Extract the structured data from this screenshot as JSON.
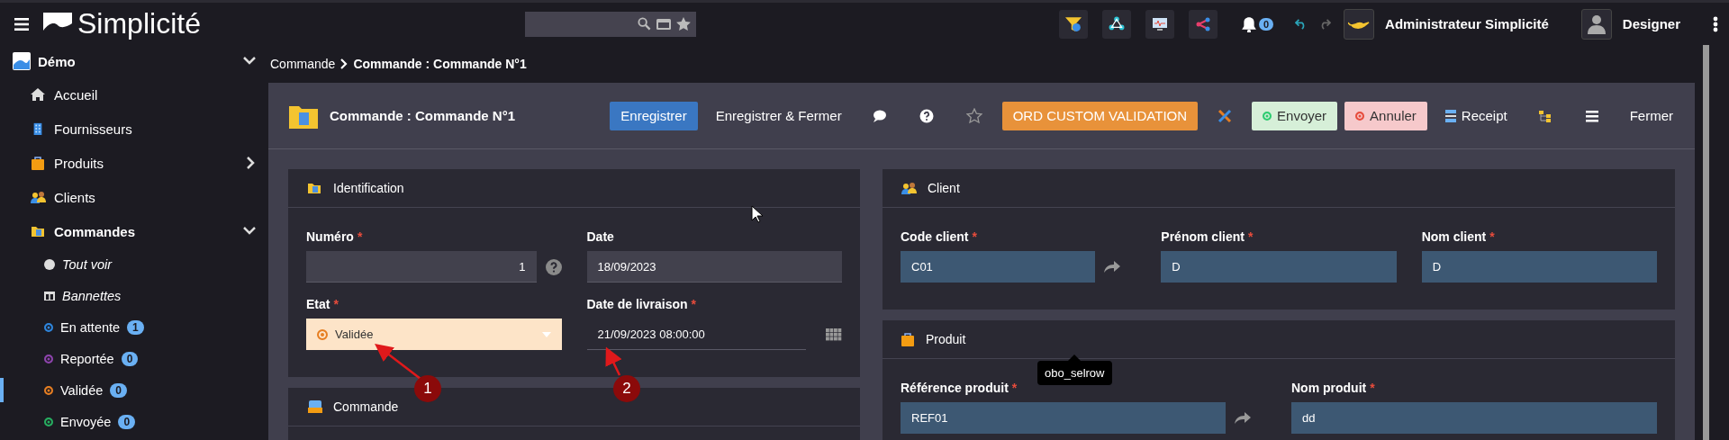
{
  "topbar": {
    "app_name": "Simplicité",
    "notification_count": "0",
    "user": "Administrateur Simplicité",
    "scope": "Designer"
  },
  "sidebar": {
    "group": {
      "label": "Démo",
      "expanded": true
    },
    "items": [
      {
        "label": "Accueil",
        "kind": "link"
      },
      {
        "label": "Fournisseurs",
        "kind": "link"
      },
      {
        "label": "Produits",
        "kind": "folder",
        "expanded": false
      },
      {
        "label": "Clients",
        "kind": "link"
      },
      {
        "label": "Commandes",
        "kind": "folder",
        "expanded": true,
        "children": [
          {
            "label": "Tout voir",
            "kind": "action",
            "selected": false
          },
          {
            "label": "Bannettes",
            "kind": "action",
            "selected": false
          },
          {
            "label": "En attente",
            "kind": "state",
            "color": "#2e86de",
            "count": "1",
            "selected": false
          },
          {
            "label": "Reportée",
            "kind": "state",
            "color": "#8e44ad",
            "count": "0",
            "selected": false
          },
          {
            "label": "Validée",
            "kind": "state",
            "color": "#e67e22",
            "count": "0",
            "selected": true
          },
          {
            "label": "Envoyée",
            "kind": "state",
            "color": "#27ae60",
            "count": "0",
            "selected": false
          }
        ]
      }
    ]
  },
  "breadcrumb": [
    "Commande",
    "Commande : Commande N°1"
  ],
  "form": {
    "title": "Commande : Commande N°1",
    "actions": [
      {
        "label": "Enregistrer",
        "kind": "primary"
      },
      {
        "label": "Enregistrer & Fermer",
        "kind": "text"
      },
      {
        "kind": "icon"
      },
      {
        "kind": "icon"
      },
      {
        "kind": "icon"
      },
      {
        "label": "ORD CUSTOM VALIDATION",
        "kind": "warning"
      },
      {
        "kind": "icon"
      },
      {
        "label": "Envoyer",
        "kind": "success"
      },
      {
        "label": "Annuler",
        "kind": "danger"
      },
      {
        "label": "Receipt",
        "kind": "text-icon"
      },
      {
        "kind": "icon"
      },
      {
        "kind": "icon"
      },
      {
        "label": "Fermer",
        "kind": "text"
      }
    ]
  },
  "columns": [
    {
      "sections": [
        {
          "title": "Identification",
          "fields": [
            {
              "label": "Numéro",
              "required_mark": "*",
              "value": "1",
              "kind": "number"
            },
            {
              "label": "Date",
              "value": "18/09/2023",
              "kind": "text"
            },
            {
              "label": "Etat",
              "required_mark": "*",
              "value": "Validée",
              "kind": "select",
              "color": "#e67e22"
            },
            {
              "label": "Date de livraison",
              "required_mark": "*",
              "value": "21/09/2023 08:00:00",
              "kind": "datetime"
            }
          ]
        },
        {
          "title": "Commande"
        }
      ]
    },
    {
      "sections": [
        {
          "title": "Client",
          "fields": [
            {
              "label": "Code client",
              "required_mark": "*",
              "value": "C01",
              "kind": "reference"
            },
            {
              "label": "Prénom client",
              "required_mark": "*",
              "value": "D",
              "kind": "lookup"
            },
            {
              "label": "Nom client",
              "required_mark": "*",
              "value": "D",
              "kind": "lookup"
            }
          ]
        },
        {
          "title": "Produit",
          "fields": [
            {
              "label": "Référence produit",
              "required_mark": "*",
              "value": "REF01",
              "kind": "reference"
            },
            {
              "label": "Nom produit",
              "required_mark": "*",
              "value": "dd",
              "kind": "lookup"
            }
          ]
        }
      ]
    }
  ],
  "tooltip": "obo_selrow",
  "annotations": [
    "1",
    "2"
  ]
}
